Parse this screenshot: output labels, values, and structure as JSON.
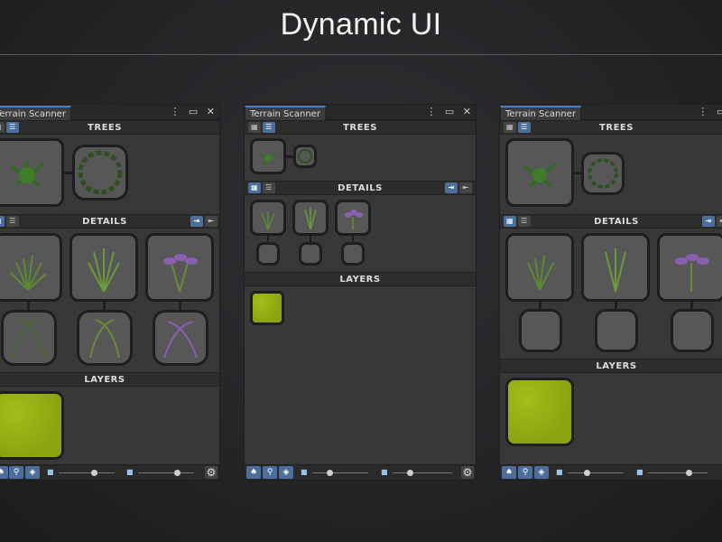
{
  "headline": "Dynamic UI",
  "panels": [
    {
      "tab": "Terrain Scanner",
      "sections": {
        "trees": "TREES",
        "details": "DETAILS",
        "layers": "LAYERS"
      }
    },
    {
      "tab": "Terrain Scanner",
      "sections": {
        "trees": "TREES",
        "details": "DETAILS",
        "layers": "LAYERS"
      }
    },
    {
      "tab": "Terrain Scanner",
      "sections": {
        "trees": "TREES",
        "details": "DETAILS",
        "layers": "LAYERS"
      }
    }
  ],
  "window_icons": "⋮ ▭ ✕",
  "icons": {
    "grid_view": "grid-view-icon",
    "list_view": "list-view-icon",
    "expand": "expand-icon",
    "collapse": "collapse-icon",
    "tree": "tree-icon",
    "detail": "detail-icon",
    "layer": "layer-icon",
    "settings": "gear-icon"
  },
  "colors": {
    "accent": "#4b6f9a",
    "layer": "#93ad12",
    "panel": "#383838"
  }
}
